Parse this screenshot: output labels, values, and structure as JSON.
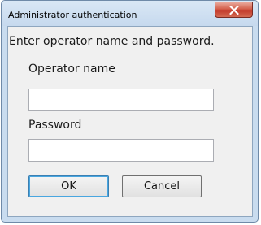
{
  "window": {
    "title": "Administrator authentication"
  },
  "dialog": {
    "instruction": "Enter operator name and password.",
    "operator_name_label": "Operator name",
    "operator_name_value": "",
    "password_label": "Password",
    "password_value": "",
    "ok_label": "OK",
    "cancel_label": "Cancel"
  },
  "icons": {
    "close": "close-icon"
  },
  "colors": {
    "close_button": "#c2392a",
    "titlebar": "#c9dcef"
  }
}
